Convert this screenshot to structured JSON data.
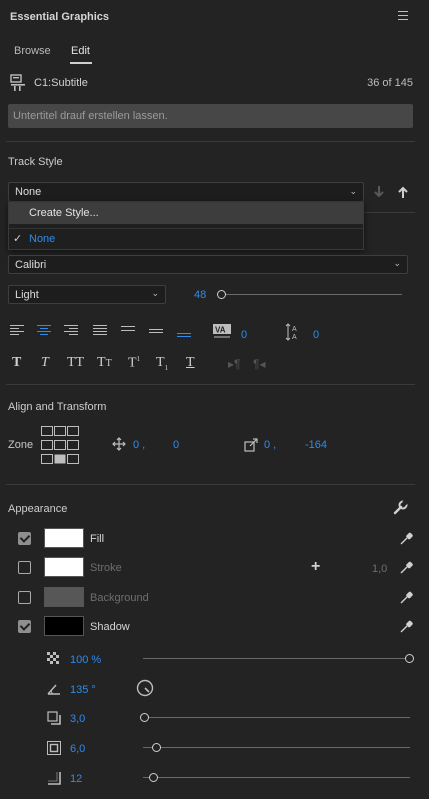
{
  "panel": {
    "title": "Essential Graphics",
    "menu_icon": "hamburger-icon"
  },
  "tabs": [
    {
      "label": "Browse",
      "active": false
    },
    {
      "label": "Edit",
      "active": true
    }
  ],
  "caption": {
    "name": "C1:Subtitle",
    "count": "36 of 145",
    "text": "Untertitel drauf erstellen lassen."
  },
  "track_style": {
    "label": "Track Style",
    "selected": "None",
    "menu": {
      "highlighted": "Create Style...",
      "options": [
        "None"
      ],
      "checked": "None"
    }
  },
  "font": {
    "family": "Calibri",
    "style": "Light",
    "size": "48"
  },
  "alignment": {
    "tracking_value": "0",
    "leading_value": "0"
  },
  "align_transform": {
    "label": "Align and Transform",
    "zone_label": "Zone",
    "position_x": "0 ,",
    "position_y": "0",
    "anchor_x": "0 ,",
    "anchor_y": "-164"
  },
  "appearance": {
    "label": "Appearance",
    "fill": {
      "label": "Fill",
      "checked": true,
      "color": "#ffffff"
    },
    "stroke": {
      "label": "Stroke",
      "checked": false,
      "color": "#ffffff",
      "width": "1,0"
    },
    "background": {
      "label": "Background",
      "checked": false,
      "color": "#575757"
    },
    "shadow": {
      "label": "Shadow",
      "checked": true,
      "color": "#000000"
    },
    "shadow_opacity": {
      "value": "100 %",
      "fraction": 1.0
    },
    "shadow_angle": "135 °",
    "shadow_distance": {
      "value": "3,0",
      "fraction": 0.0
    },
    "shadow_size": {
      "value": "6,0",
      "fraction": 0.05
    },
    "shadow_blur": {
      "value": "12",
      "fraction": 0.03
    }
  },
  "colors": {
    "accent": "#2d8ceb",
    "panel_bg": "#232323"
  }
}
